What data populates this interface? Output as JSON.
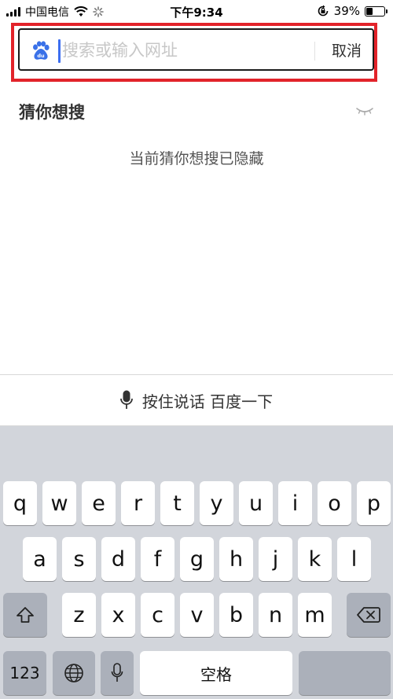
{
  "status_bar": {
    "carrier": "中国电信",
    "time": "下午9:34",
    "battery_percent": "39%",
    "battery_level": 0.39,
    "icons": [
      "signal-icon",
      "wifi-icon",
      "loading-icon",
      "orientation-lock-icon",
      "battery-icon"
    ]
  },
  "search": {
    "placeholder": "搜索或输入网址",
    "value": "",
    "cancel_label": "取消",
    "logo_icon": "baidu-paw-icon",
    "highlight_color": "#e2232a",
    "cursor_color": "#3c6ef0"
  },
  "suggestions": {
    "title": "猜你想搜",
    "toggle_icon": "eye-closed-icon",
    "hidden_note": "当前猜你想搜已隐藏"
  },
  "voice_bar": {
    "icon": "microphone-icon",
    "label": "按住说话 百度一下"
  },
  "keyboard": {
    "row1": [
      "q",
      "w",
      "e",
      "r",
      "t",
      "y",
      "u",
      "i",
      "o",
      "p"
    ],
    "row2": [
      "a",
      "s",
      "d",
      "f",
      "g",
      "h",
      "j",
      "k",
      "l"
    ],
    "row3": [
      "z",
      "x",
      "c",
      "v",
      "b",
      "n",
      "m"
    ],
    "shift_icon": "shift-icon",
    "delete_icon": "backspace-icon",
    "numbers_label": "123",
    "globe_icon": "globe-icon",
    "dictation_icon": "microphone-icon",
    "space_label": "空格"
  }
}
